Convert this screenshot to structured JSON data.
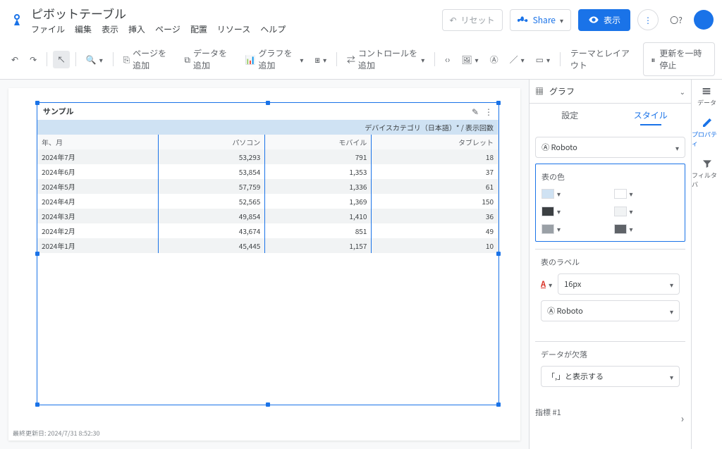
{
  "doc_title": "ピボットテーブル",
  "menus": [
    "ファイル",
    "編集",
    "表示",
    "挿入",
    "ページ",
    "配置",
    "リソース",
    "ヘルプ"
  ],
  "header": {
    "reset": "リセット",
    "share": "Share",
    "view": "表示"
  },
  "toolbar": {
    "add_page": "ページを追加",
    "add_data": "データを追加",
    "add_chart": "グラフを追加",
    "add_control": "コントロールを追加",
    "theme": "テーマとレイアウト",
    "pause": "更新を一時停止"
  },
  "chart_data": {
    "type": "table",
    "table_title": "サンプル",
    "column_header": "デバイスカテゴリ（日本語）* / 表示回数",
    "columns": [
      "年、月",
      "パソコン",
      "モバイル",
      "タブレット"
    ],
    "rows": [
      {
        "ym": "2024年7月",
        "pc": "53,293",
        "mb": "791",
        "tb": "18"
      },
      {
        "ym": "2024年6月",
        "pc": "53,854",
        "mb": "1,353",
        "tb": "37"
      },
      {
        "ym": "2024年5月",
        "pc": "57,759",
        "mb": "1,336",
        "tb": "61"
      },
      {
        "ym": "2024年4月",
        "pc": "52,565",
        "mb": "1,369",
        "tb": "150"
      },
      {
        "ym": "2024年3月",
        "pc": "49,854",
        "mb": "1,410",
        "tb": "36"
      },
      {
        "ym": "2024年2月",
        "pc": "43,674",
        "mb": "851",
        "tb": "49"
      },
      {
        "ym": "2024年1月",
        "pc": "45,445",
        "mb": "1,157",
        "tb": "10"
      }
    ]
  },
  "footer": "最終更新日: 2024/7/31 8:52:30",
  "side": {
    "title": "グラフ",
    "tab_setup": "設定",
    "tab_style": "スタイル",
    "font_family": "Roboto",
    "table_colors": "表の色",
    "table_labels": "表のラベル",
    "label_size": "16px",
    "missing": "データが欠落",
    "missing_opt": "「,」と表示する",
    "metric": "指標 #1"
  },
  "rail": {
    "data": "データ",
    "props": "プロパティ",
    "filters": "フィルタバ"
  }
}
